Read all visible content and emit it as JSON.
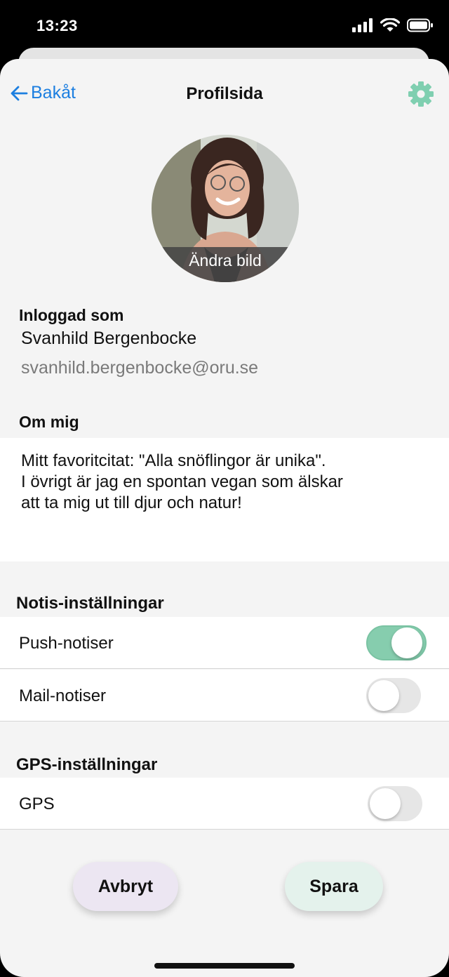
{
  "status_bar": {
    "time": "13:23"
  },
  "nav": {
    "back_label": "Bakåt",
    "title": "Profilsida"
  },
  "avatar": {
    "change_label": "Ändra bild"
  },
  "account": {
    "heading": "Inloggad som",
    "name": "Svanhild Bergenbocke",
    "email": "svanhild.bergenbocke@oru.se"
  },
  "about": {
    "heading": "Om mig",
    "text": "Mitt favoritcitat: \"Alla snöflingor är unika\".\nI övrigt är jag en spontan vegan som älskar\natt ta mig ut till djur och natur!"
  },
  "notifications": {
    "heading": "Notis-inställningar",
    "items": [
      {
        "label": "Push-notiser",
        "enabled": true
      },
      {
        "label": "Mail-notiser",
        "enabled": false
      }
    ]
  },
  "gps": {
    "heading": "GPS-inställningar",
    "items": [
      {
        "label": "GPS",
        "enabled": false
      }
    ]
  },
  "actions": {
    "cancel_label": "Avbryt",
    "save_label": "Spara"
  },
  "colors": {
    "accent": "#1d7fe0",
    "toggle_on": "#86cdae",
    "gear": "#7fcfb0",
    "cancel_bg": "#ece6f2",
    "save_bg": "#e4f2ec"
  }
}
